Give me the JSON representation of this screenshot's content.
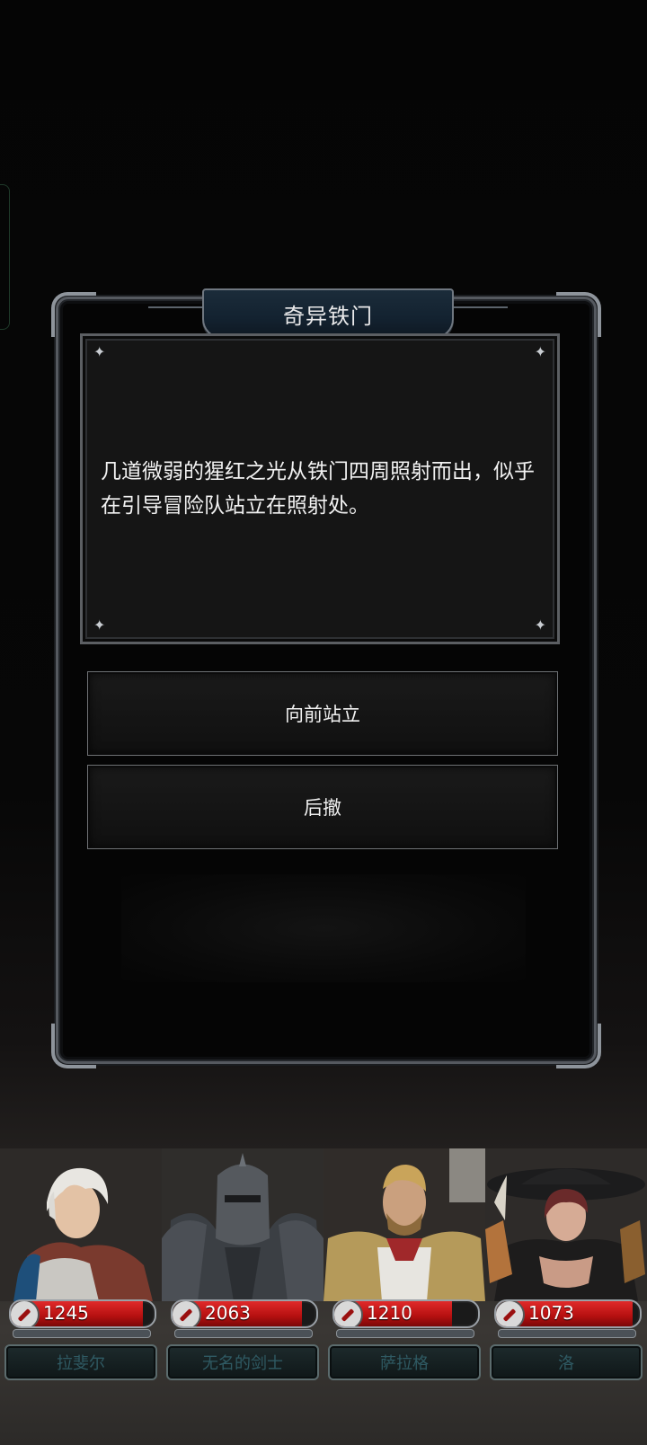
{
  "event": {
    "title": "奇异铁门",
    "description": "几道微弱的猩红之光从铁门四周照射而出，似乎在引导冒险队站立在照射处。",
    "choices": [
      {
        "label": "向前站立"
      },
      {
        "label": "后撤"
      }
    ]
  },
  "party": [
    {
      "name": "拉斐尔",
      "hp": "1245",
      "hp_fraction": 0.92
    },
    {
      "name": "无名的剑士",
      "hp": "2063",
      "hp_fraction": 0.9
    },
    {
      "name": "萨拉格",
      "hp": "1210",
      "hp_fraction": 0.82
    },
    {
      "name": "洛",
      "hp": "1073",
      "hp_fraction": 0.95
    }
  ],
  "icons": {
    "sparkle": "✦",
    "hp": "sword-icon"
  },
  "colors": {
    "hp_red": "#c01515",
    "title_plate": "#132230",
    "name_text": "#2f5a63"
  }
}
